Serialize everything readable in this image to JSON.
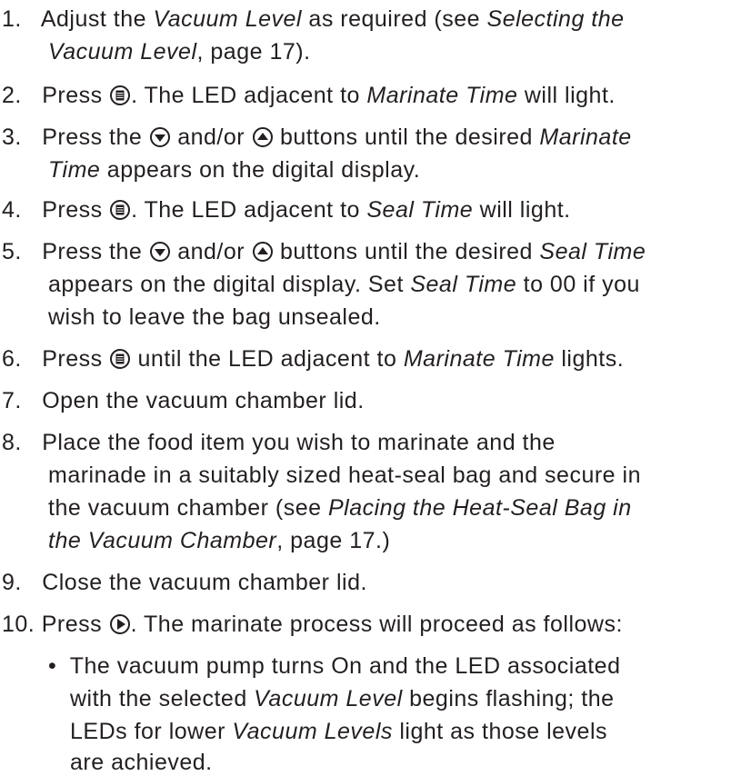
{
  "colors": {
    "text": "#231f20"
  },
  "icons": {
    "menu": "menu-button-icon",
    "down": "down-arrow-button-icon",
    "up": "up-arrow-button-icon",
    "start": "start-button-icon"
  },
  "steps": [
    {
      "number": "1.",
      "lines": [
        [
          "Adjust the ",
          "Vacuum Level",
          " as required (see ",
          "Selecting the"
        ],
        [
          "Vacuum Level",
          ", page 17)."
        ]
      ]
    },
    {
      "number": "2.",
      "lines": [
        [
          "Press ",
          ". The LED adjacent to ",
          "Marinate Time",
          " will light."
        ]
      ]
    },
    {
      "number": "3.",
      "lines": [
        [
          "Press the ",
          " and/or ",
          " buttons until the desired ",
          "Marinate"
        ],
        [
          "Time",
          " appears on the digital display."
        ]
      ]
    },
    {
      "number": "4.",
      "lines": [
        [
          "Press ",
          ". The LED adjacent to ",
          "Seal Time",
          " will light."
        ]
      ]
    },
    {
      "number": "5.",
      "lines": [
        [
          "Press the ",
          " and/or ",
          " buttons until the desired ",
          "Seal Time"
        ],
        [
          "appears on the digital display. Set ",
          "Seal Time",
          " to 00 if you"
        ],
        [
          "wish to leave the bag unsealed."
        ]
      ]
    },
    {
      "number": "6.",
      "lines": [
        [
          "Press ",
          " until the LED adjacent to ",
          "Marinate Time",
          " lights."
        ]
      ]
    },
    {
      "number": "7.",
      "lines": [
        [
          "Open the vacuum chamber lid."
        ]
      ]
    },
    {
      "number": "8.",
      "lines": [
        [
          "Place the food item you wish to marinate and the"
        ],
        [
          "marinade in a suitably sized heat-seal bag and secure in"
        ],
        [
          "the vacuum chamber (see ",
          "Placing the Heat-Seal Bag in"
        ],
        [
          "the Vacuum Chamber",
          ", page 17.)"
        ]
      ]
    },
    {
      "number": "9.",
      "lines": [
        [
          "Close the vacuum chamber lid."
        ]
      ]
    },
    {
      "number": "10.",
      "lines": [
        [
          "Press ",
          ". The marinate process will proceed as follows:"
        ]
      ]
    }
  ],
  "bullet": {
    "mark": "•",
    "lines": [
      [
        "The vacuum pump turns On and the LED associated"
      ],
      [
        "with the selected ",
        "Vacuum Level",
        " begins flashing; the"
      ],
      [
        "LEDs for lower ",
        "Vacuum Levels",
        " light as those levels"
      ],
      [
        "are achieved."
      ]
    ]
  }
}
